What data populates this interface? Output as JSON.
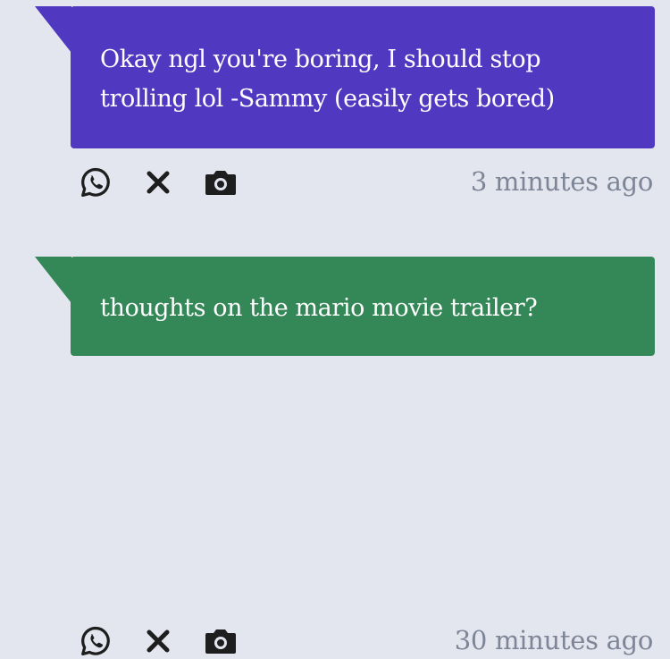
{
  "colors": {
    "background": "#e3e6ef",
    "purple_bubble": "#5038c0",
    "green_bubble": "#348757",
    "bubble_text": "#ffffff",
    "timestamp_text": "#7d8596",
    "icon": "#1e1e1e"
  },
  "messages": [
    {
      "text": "Okay ngl you're boring, I should stop trolling lol -Sammy (easily gets bored)",
      "bubble_color": "purple",
      "timestamp": "3 minutes ago",
      "actions": [
        "whatsapp-icon",
        "close-icon",
        "camera-icon"
      ]
    },
    {
      "text": "thoughts on the mario movie trailer?",
      "bubble_color": "green",
      "timestamp": "30 minutes ago",
      "actions": [
        "whatsapp-icon",
        "close-icon",
        "camera-icon"
      ]
    }
  ]
}
